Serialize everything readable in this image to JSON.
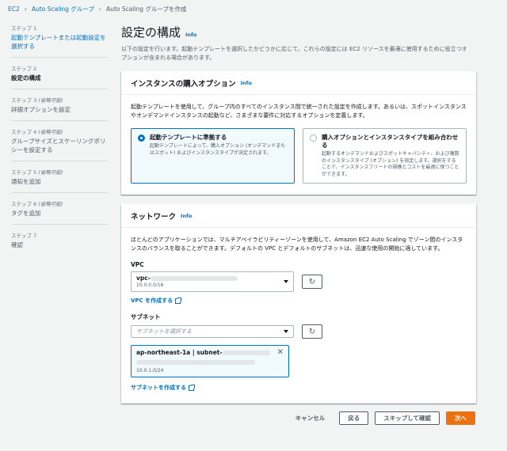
{
  "breadcrumb": {
    "items": [
      "EC2",
      "Auto Scaling グループ",
      "Auto Scaling グループを作成"
    ],
    "separator": "›"
  },
  "sidebar": {
    "steps": [
      {
        "label": "ステップ 1",
        "optional": "",
        "title": "起動テンプレートまたは起動設定を選択する",
        "state": "link"
      },
      {
        "label": "ステップ 2",
        "optional": "",
        "title": "設定の構成",
        "state": "active"
      },
      {
        "label": "ステップ 3",
        "optional": "(省略可能)",
        "title": "詳細オプションを設定",
        "state": "inactive"
      },
      {
        "label": "ステップ 4",
        "optional": "(省略可能)",
        "title": "グループサイズとスケーリングポリシーを設定する",
        "state": "inactive"
      },
      {
        "label": "ステップ 5",
        "optional": "(省略可能)",
        "title": "通知を追加",
        "state": "inactive"
      },
      {
        "label": "ステップ 6",
        "optional": "(省略可能)",
        "title": "タグを追加",
        "state": "inactive"
      },
      {
        "label": "ステップ 7",
        "optional": "",
        "title": "確認",
        "state": "inactive"
      }
    ]
  },
  "main": {
    "title": "設定の構成",
    "info": "Info",
    "description": "以下の設定を行います。起動テンプレートを選択したかどうかに応じて、これらの設定には EC2 リソースを最適に使用するために役立つオプションが含まれる場合があります。"
  },
  "purchase": {
    "title": "インスタンスの購入オプション",
    "info": "Info",
    "description": "起動テンプレートを使用して、グループ内のすべてのインスタンス間で統一された設定を作成します。あるいは、スポットインスタンスやオンデマンドインスタンスの起動など、さまざまな要件に対応するオプションを定義します。",
    "options": [
      {
        "title": "起動テンプレートに準拠する",
        "desc": "起動テンプレートによって、購入オプション (オンデマンドまたはスポット) およびインスタンスタイプが決定されます。",
        "selected": true
      },
      {
        "title": "購入オプションとインスタンスタイプを組み合わせる",
        "desc": "起動するオンデマンドおよびスポットキャパシティ、および複数のインスタンスタイプ (オプション) を指定します。選択をすることで、インスタンスフリートの規模とコストを最適に保つことができます。",
        "selected": false
      }
    ]
  },
  "network": {
    "title": "ネットワーク",
    "info": "Info",
    "description": "ほとんどのアプリケーションでは、マルチアベイラビリティーゾーンを使用して、Amazon EC2 Auto Scaling でゾーン間のインスタンスのバランスを取ることができます。デフォルトの VPC とデフォルトのサブネットは、迅速な使用の開始に適しています。",
    "vpc_label": "VPC",
    "vpc_value": "vpc-",
    "vpc_cidr": "10.0.0.0/16",
    "create_vpc": "VPC を作成する",
    "subnet_label": "サブネット",
    "subnet_placeholder": "サブネットを選択する",
    "subnet_token": "ap-northeast-1a | subnet-",
    "subnet_cidr": "10.0.1.0/24",
    "create_subnet": "サブネットを作成する"
  },
  "footer": {
    "cancel": "キャンセル",
    "back": "戻る",
    "skip": "スキップして確認",
    "next": "次へ"
  },
  "colors": {
    "link": "#0073bb",
    "primary": "#ec7211",
    "background": "#f2f3f3"
  }
}
